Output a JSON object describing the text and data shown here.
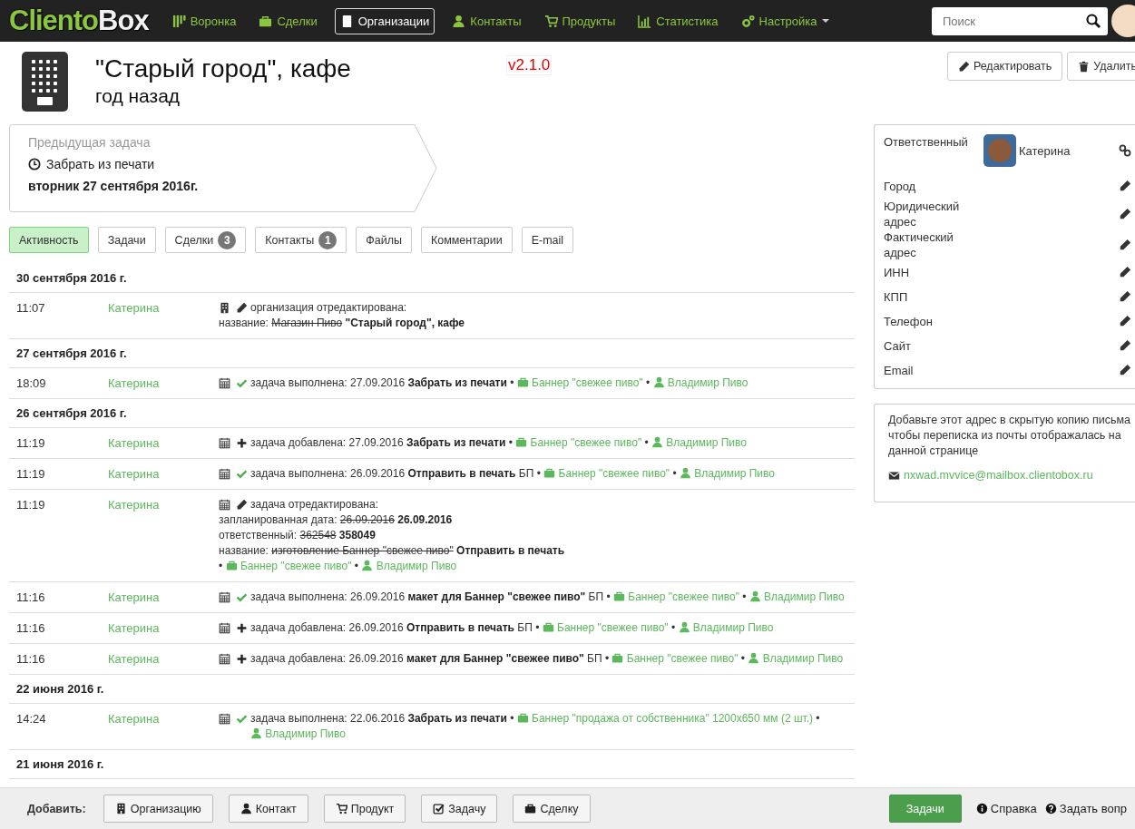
{
  "nav": {
    "logo": {
      "part_1": "Cliento",
      "part_2": "Box"
    },
    "items": [
      {
        "label": "Воронка",
        "selected": false,
        "dropdown": false
      },
      {
        "label": "Сделки",
        "selected": false,
        "dropdown": false
      },
      {
        "label": "Организации",
        "selected": true,
        "dropdown": false
      },
      {
        "label": "Контакты",
        "selected": false,
        "dropdown": false
      },
      {
        "label": "Продукты",
        "selected": false,
        "dropdown": false
      },
      {
        "label": "Статистика",
        "selected": false,
        "dropdown": false
      },
      {
        "label": "Настройка",
        "selected": false,
        "dropdown": true
      }
    ],
    "search": {
      "placeholder": "Поиск"
    }
  },
  "header": {
    "title": "\"Старый город\", кафе",
    "subtitle": "год назад",
    "version": "v2.1.0",
    "buttons": [
      "Редактировать",
      "Удалить"
    ]
  },
  "previous_task": {
    "heading": "Предыдущая задача",
    "task": "Забрать из печати",
    "date": "вторник 27 сентября 2016г."
  },
  "tabs": [
    {
      "label": "Активность",
      "selected": true
    },
    {
      "label": "Задачи",
      "selected": false
    },
    {
      "label": "Сделки",
      "selected": false,
      "count": "3"
    },
    {
      "label": "Контакты",
      "selected": false,
      "count": "1"
    },
    {
      "label": "Файлы",
      "selected": false
    },
    {
      "label": "Комментарии",
      "selected": false
    },
    {
      "label": "E-mail",
      "selected": false
    }
  ],
  "feed": [
    {
      "date": "30 сентября 2016 г.",
      "entries": [
        {
          "time": "11:07",
          "user": "Катерина",
          "kind": "org_edited",
          "lines": [
            [
              {
                "kind": "plain",
                "text": "организация отредактирована:"
              }
            ],
            [
              {
                "kind": "plain",
                "text": "название:"
              },
              {
                "kind": "old",
                "text": "Магазин Пиво"
              },
              {
                "kind": "bold",
                "text": "\"Старый город\", кафе"
              }
            ]
          ]
        }
      ]
    },
    {
      "date": "27 сентября 2016 г.",
      "entries": [
        {
          "time": "18:09",
          "user": "Катерина",
          "kind": "task_done",
          "lines": [
            [
              {
                "kind": "plain",
                "text": "задача выполнена: 27.09.2016"
              },
              {
                "kind": "bold",
                "text": "Забрать из печати"
              },
              {
                "kind": "plain",
                "text": "•"
              },
              {
                "kind": "deal",
                "text": "Баннер \"свежее пиво\""
              },
              {
                "kind": "plain",
                "text": "•"
              },
              {
                "kind": "contact",
                "text": "Владимир Пиво"
              }
            ]
          ]
        }
      ]
    },
    {
      "date": "26 сентября 2016 г.",
      "entries": [
        {
          "time": "11:19",
          "user": "Катерина",
          "kind": "task_added",
          "lines": [
            [
              {
                "kind": "plain",
                "text": "задача добавлена: 27.09.2016"
              },
              {
                "kind": "bold",
                "text": "Забрать из печати"
              },
              {
                "kind": "plain",
                "text": "•"
              },
              {
                "kind": "deal",
                "text": "Баннер \"свежее пиво\""
              },
              {
                "kind": "plain",
                "text": "•"
              },
              {
                "kind": "contact",
                "text": "Владимир Пиво"
              }
            ]
          ]
        },
        {
          "time": "11:19",
          "user": "Катерина",
          "kind": "task_done",
          "lines": [
            [
              {
                "kind": "plain",
                "text": "задача выполнена: 26.09.2016"
              },
              {
                "kind": "bold",
                "text": "Отправить в печать"
              },
              {
                "kind": "plain",
                "text": "БП •"
              },
              {
                "kind": "deal",
                "text": "Баннер \"свежее пиво\""
              },
              {
                "kind": "plain",
                "text": "•"
              },
              {
                "kind": "contact",
                "text": "Владимир Пиво"
              }
            ]
          ]
        },
        {
          "time": "11:19",
          "user": "Катерина",
          "kind": "task_edited",
          "lines": [
            [
              {
                "kind": "plain",
                "text": "задача отредактирована:"
              }
            ],
            [
              {
                "kind": "plain",
                "text": "запланированная дата:"
              },
              {
                "kind": "old",
                "text": "26.09.2016"
              },
              {
                "kind": "bold",
                "text": "26.09.2016"
              }
            ],
            [
              {
                "kind": "plain",
                "text": "ответственный:"
              },
              {
                "kind": "old",
                "text": "362548"
              },
              {
                "kind": "bold",
                "text": "358049"
              }
            ],
            [
              {
                "kind": "plain",
                "text": "название:"
              },
              {
                "kind": "old",
                "text": "изготовление Баннер \"свежее пиво\""
              },
              {
                "kind": "bold",
                "text": "Отправить в печать"
              }
            ],
            [
              {
                "kind": "plain",
                "text": "•"
              },
              {
                "kind": "deal",
                "text": "Баннер \"свежее пиво\""
              },
              {
                "kind": "plain",
                "text": "•"
              },
              {
                "kind": "contact",
                "text": "Владимир Пиво"
              }
            ]
          ]
        },
        {
          "time": "11:16",
          "user": "Катерина",
          "kind": "task_done",
          "lines": [
            [
              {
                "kind": "plain",
                "text": "задача выполнена: 26.09.2016"
              },
              {
                "kind": "bold",
                "text": "макет для Баннер \"свежее пиво\""
              },
              {
                "kind": "plain",
                "text": "БП •"
              },
              {
                "kind": "deal",
                "text": "Баннер \"свежее пиво\""
              },
              {
                "kind": "plain",
                "text": "•"
              },
              {
                "kind": "contact",
                "text": "Владимир Пиво"
              }
            ]
          ]
        },
        {
          "time": "11:16",
          "user": "Катерина",
          "kind": "task_added",
          "lines": [
            [
              {
                "kind": "plain",
                "text": "задача добавлена: 26.09.2016"
              },
              {
                "kind": "bold",
                "text": "Отправить в печать"
              },
              {
                "kind": "plain",
                "text": "БП •"
              },
              {
                "kind": "deal",
                "text": "Баннер \"свежее пиво\""
              },
              {
                "kind": "plain",
                "text": "•"
              },
              {
                "kind": "contact",
                "text": "Владимир Пиво"
              }
            ]
          ]
        },
        {
          "time": "11:16",
          "user": "Катерина",
          "kind": "task_added",
          "lines": [
            [
              {
                "kind": "plain",
                "text": "задача добавлена: 26.09.2016"
              },
              {
                "kind": "bold",
                "text": "макет для Баннер \"свежее пиво\""
              },
              {
                "kind": "plain",
                "text": "БП •"
              },
              {
                "kind": "deal",
                "text": "Баннер \"свежее пиво\""
              },
              {
                "kind": "plain",
                "text": "•"
              },
              {
                "kind": "contact",
                "text": "Владимир Пиво"
              }
            ]
          ]
        }
      ]
    },
    {
      "date": "22 июня 2016 г.",
      "entries": [
        {
          "time": "14:24",
          "user": "Катерина",
          "kind": "task_done",
          "lines": [
            [
              {
                "kind": "plain",
                "text": "задача выполнена: 22.06.2016"
              },
              {
                "kind": "bold",
                "text": "Забрать из печати"
              },
              {
                "kind": "plain",
                "text": "•"
              },
              {
                "kind": "deal",
                "text": "Баннер \"продажа от собственника\" 1200x650 мм (2 шт.)"
              },
              {
                "kind": "plain",
                "text": "•"
              },
              {
                "kind": "contact",
                "text": "Владимир Пиво"
              }
            ]
          ]
        }
      ]
    },
    {
      "date": "21 июня 2016 г."
    }
  ],
  "info": {
    "fields": [
      {
        "label": "Ответственный",
        "kind": "person",
        "value": "Катерина"
      },
      {
        "label": "Город",
        "kind": "field"
      },
      {
        "label": "Юридический адрес",
        "kind": "field"
      },
      {
        "label": "Фактический адрес",
        "kind": "field"
      },
      {
        "label": "ИНН",
        "kind": "field"
      },
      {
        "label": "КПП",
        "kind": "field"
      },
      {
        "label": "Телефон",
        "kind": "field"
      },
      {
        "label": "Сайт",
        "kind": "field"
      },
      {
        "label": "Email",
        "kind": "field"
      }
    ]
  },
  "mail": {
    "text": "Добавьте этот адрес в скрытую копию письма чтобы переписка из почты отображалась на данной странице",
    "address": "nxwad.mvvice@mailbox.clientobox.ru"
  },
  "footer": {
    "label": "Добавить:",
    "buttons": [
      "Организацию",
      "Контакт",
      "Продукт",
      "Задачу",
      "Сделку"
    ],
    "tasks_button": "Задачи",
    "links": [
      "Справка",
      "Задать вопр"
    ]
  }
}
